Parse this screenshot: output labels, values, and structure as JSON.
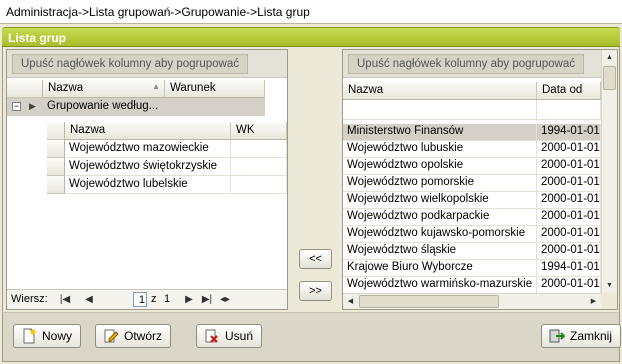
{
  "breadcrumb": "Administracja->Lista grupowań->Grupowanie->Lista grup",
  "panel_title": "Lista grup",
  "left_grid": {
    "group_hint": "Upuść nagłówek kolumny aby pogrupować",
    "columns": {
      "name": "Nazwa",
      "condition": "Warunek"
    },
    "group_row": "Grupowanie  według...",
    "detail_columns": {
      "name": "Nazwa",
      "wk": "WK"
    },
    "detail_rows": [
      "Województwo mazowieckie",
      "Województwo świętokrzyskie",
      "Województwo lubelskie"
    ],
    "navigator": {
      "label": "Wiersz:",
      "current": "1",
      "of": "z",
      "total": "1"
    }
  },
  "middle": {
    "add_all": "<<",
    "remove_all": ">>"
  },
  "right_grid": {
    "group_hint": "Upuść nagłówek kolumny aby pogrupować",
    "columns": {
      "name": "Nazwa",
      "date": "Data od"
    },
    "rows": [
      {
        "name": "Ministerstwo Finansów",
        "date": "1994-01-01"
      },
      {
        "name": "Województwo lubuskie",
        "date": "2000-01-01"
      },
      {
        "name": "Województwo opolskie",
        "date": "2000-01-01"
      },
      {
        "name": "Województwo pomorskie",
        "date": "2000-01-01"
      },
      {
        "name": "Województwo wielkopolskie",
        "date": "2000-01-01"
      },
      {
        "name": "Województwo podkarpackie",
        "date": "2000-01-01"
      },
      {
        "name": "Województwo kujawsko-pomorskie",
        "date": "2000-01-01"
      },
      {
        "name": "Województwo śląskie",
        "date": "2000-01-01"
      },
      {
        "name": "Krajowe Biuro Wyborcze",
        "date": "1994-01-01"
      },
      {
        "name": "Województwo  warmińsko-mazurskie",
        "date": "2000-01-01"
      }
    ]
  },
  "buttons": {
    "new": "Nowy",
    "open": "Otwórz",
    "delete": "Usuń",
    "close": "Zamknij"
  },
  "colors": {
    "title_bar": "#b5c93a",
    "selected_row": "#d4d0c8"
  }
}
